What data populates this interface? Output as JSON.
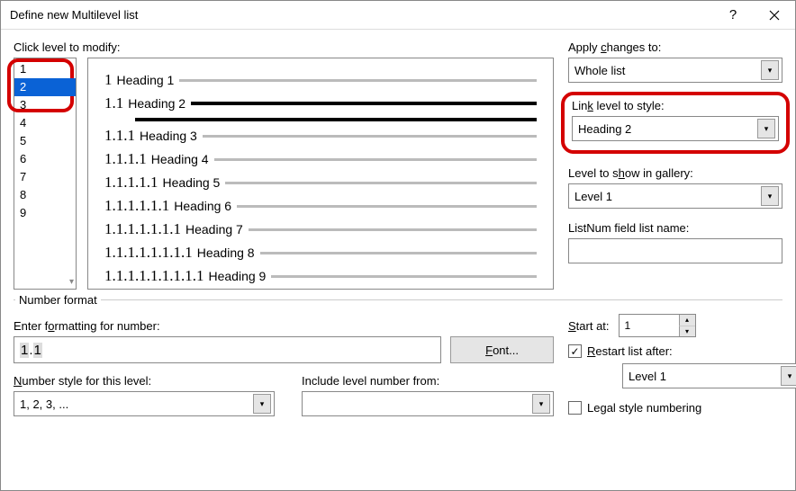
{
  "title": "Define new Multilevel list",
  "clickLevelLabel": "Click level to modify:",
  "levels": [
    "1",
    "2",
    "3",
    "4",
    "5",
    "6",
    "7",
    "8",
    "9"
  ],
  "selectedLevel": "2",
  "preview": [
    {
      "num": "1",
      "label": "Heading 1",
      "indent": 0,
      "bold": false
    },
    {
      "num": "1.1",
      "label": "Heading 2",
      "indent": 0,
      "bold": true,
      "extraLine": true
    },
    {
      "num": "1.1.1",
      "label": "Heading 3",
      "indent": 0,
      "bold": false
    },
    {
      "num": "1.1.1.1",
      "label": "Heading 4",
      "indent": 0,
      "bold": false
    },
    {
      "num": "1.1.1.1.1",
      "label": "Heading 5",
      "indent": 0,
      "bold": false
    },
    {
      "num": "1.1.1.1.1.1",
      "label": "Heading 6",
      "indent": 0,
      "bold": false
    },
    {
      "num": "1.1.1.1.1.1.1",
      "label": "Heading 7",
      "indent": 0,
      "bold": false
    },
    {
      "num": "1.1.1.1.1.1.1.1",
      "label": "Heading 8",
      "indent": 0,
      "bold": false
    },
    {
      "num": "1.1.1.1.1.1.1.1.1",
      "label": "Heading 9",
      "indent": 0,
      "bold": false
    }
  ],
  "right": {
    "applyChangesLabel": "Apply changes to:",
    "applyChangesValue": "Whole list",
    "linkLevelLabel": "Link level to style:",
    "linkLevelValue": "Heading 2",
    "galleryLabel": "Level to show in gallery:",
    "galleryValue": "Level 1",
    "listnumLabel": "ListNum field list name:",
    "listnumValue": ""
  },
  "numFormat": {
    "legend": "Number format",
    "enterLabel": "Enter formatting for number:",
    "enterValueA": "1",
    "enterValueB": ".",
    "enterValueC": "1",
    "fontBtn": "Font...",
    "numStyleLabel": "Number style for this level:",
    "numStyleValue": "1, 2, 3, ...",
    "includeLabel": "Include level number from:",
    "includeValue": ""
  },
  "start": {
    "label": "Start at:",
    "value": "1",
    "restartLabel": "Restart list after:",
    "restartChecked": true,
    "restartValue": "Level 1",
    "legalLabel": "Legal style numbering",
    "legalChecked": false
  }
}
